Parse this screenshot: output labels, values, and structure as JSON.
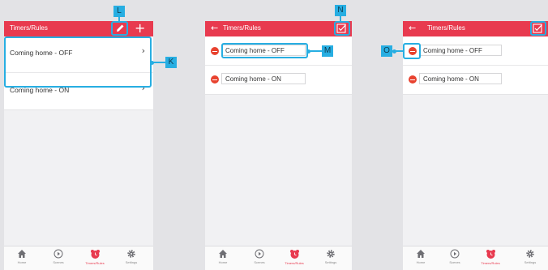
{
  "phone1": {
    "header_title": "Timers/Rules",
    "rows": [
      {
        "label": "Coming home - OFF"
      },
      {
        "label": "Coming home - ON"
      }
    ]
  },
  "phone2": {
    "header_title": "Timers/Rules",
    "rows": [
      {
        "label": "Coming home - OFF"
      },
      {
        "label": "Coming home - ON"
      }
    ]
  },
  "phone3": {
    "header_title": "Timers/Rules",
    "rows": [
      {
        "label": "Coming home - OFF"
      },
      {
        "label": "Coming home - ON"
      }
    ]
  },
  "tabbar": {
    "items": [
      {
        "label": "Home",
        "icon": "home-icon"
      },
      {
        "label": "Scenes",
        "icon": "play-circle-icon"
      },
      {
        "label": "Timers/Rules",
        "icon": "alarm-clock-icon"
      },
      {
        "label": "Settings",
        "icon": "gear-icon"
      }
    ]
  },
  "callouts": {
    "k": "K",
    "l": "L",
    "m": "M",
    "n": "N",
    "o": "O"
  },
  "icons": {
    "back": "back-arrow-icon",
    "add": "plus-icon",
    "edit": "pencil-icon",
    "done": "checkbox-icon",
    "delete": "minus-circle-icon",
    "chevron": "chevron-right-icon"
  },
  "colors": {
    "header": "#e83a4f",
    "highlight": "#27aee2",
    "delete": "#e8422f",
    "background": "#e3e3e6"
  }
}
